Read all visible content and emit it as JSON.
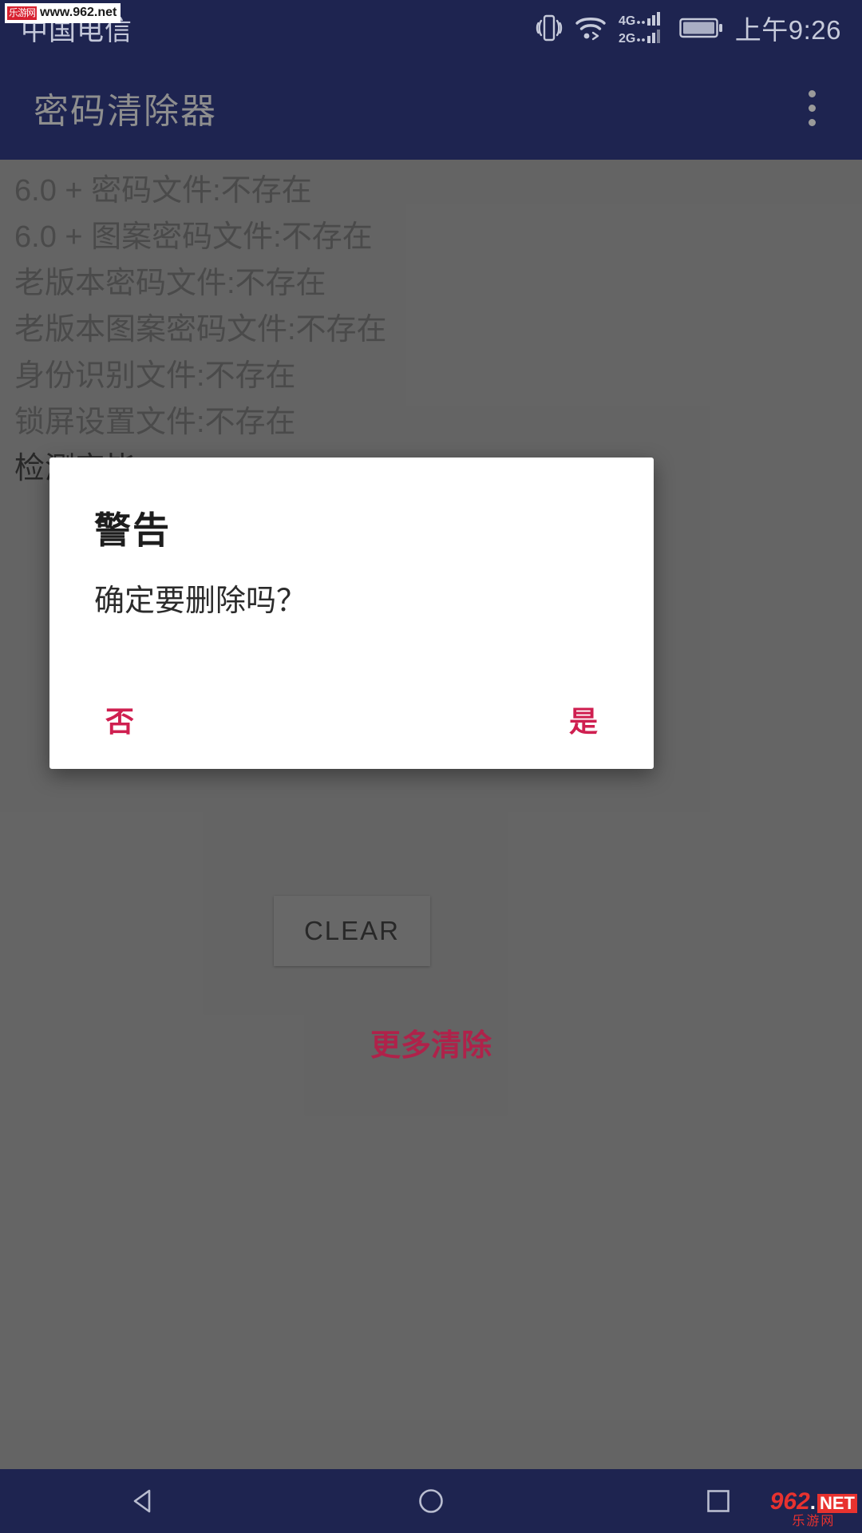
{
  "status_bar": {
    "carrier": "中国电信",
    "clock": "上午9:26",
    "icons": [
      "vibrate-icon",
      "wifi-icon",
      "signal-4g-icon",
      "signal-2g-icon",
      "battery-icon"
    ],
    "signal_primary_label": "4G",
    "signal_secondary_label": "2G"
  },
  "watermark": {
    "logo_text": "乐游网",
    "url": "www.962.net"
  },
  "app_bar": {
    "title": "密码清除器",
    "overflow_menu": "more-options"
  },
  "content": {
    "log_lines": [
      {
        "text": "6.0 + 密码文件:不存在",
        "emphasis": false
      },
      {
        "text": "6.0 + 图案密码文件:不存在",
        "emphasis": false
      },
      {
        "text": "老版本密码文件:不存在",
        "emphasis": false
      },
      {
        "text": "老版本图案密码文件:不存在",
        "emphasis": false
      },
      {
        "text": "身份识别文件:不存在",
        "emphasis": false
      },
      {
        "text": "锁屏设置文件:不存在",
        "emphasis": false
      },
      {
        "text": "检测完毕.",
        "emphasis": true
      }
    ],
    "clear_button": "CLEAR",
    "more_clear_link": "更多清除"
  },
  "dialog": {
    "title": "警告",
    "message": "确定要删除吗？",
    "negative_button": "否",
    "positive_button": "是",
    "accent_color": "#cf1f50"
  },
  "nav_bar": {
    "back": "back-triangle-icon",
    "home": "home-circle-icon",
    "recents": "recents-square-icon"
  },
  "site_badge": {
    "number": "962",
    "dot": ".",
    "net": "NET",
    "cn": "乐游网"
  },
  "colors": {
    "status_bar_bg": "#1e2450",
    "app_bar_bg": "#1e2450",
    "content_bg": "#6a6a6a",
    "dialog_bg": "#ffffff",
    "accent": "#cf1f50",
    "link": "#b9244f"
  }
}
